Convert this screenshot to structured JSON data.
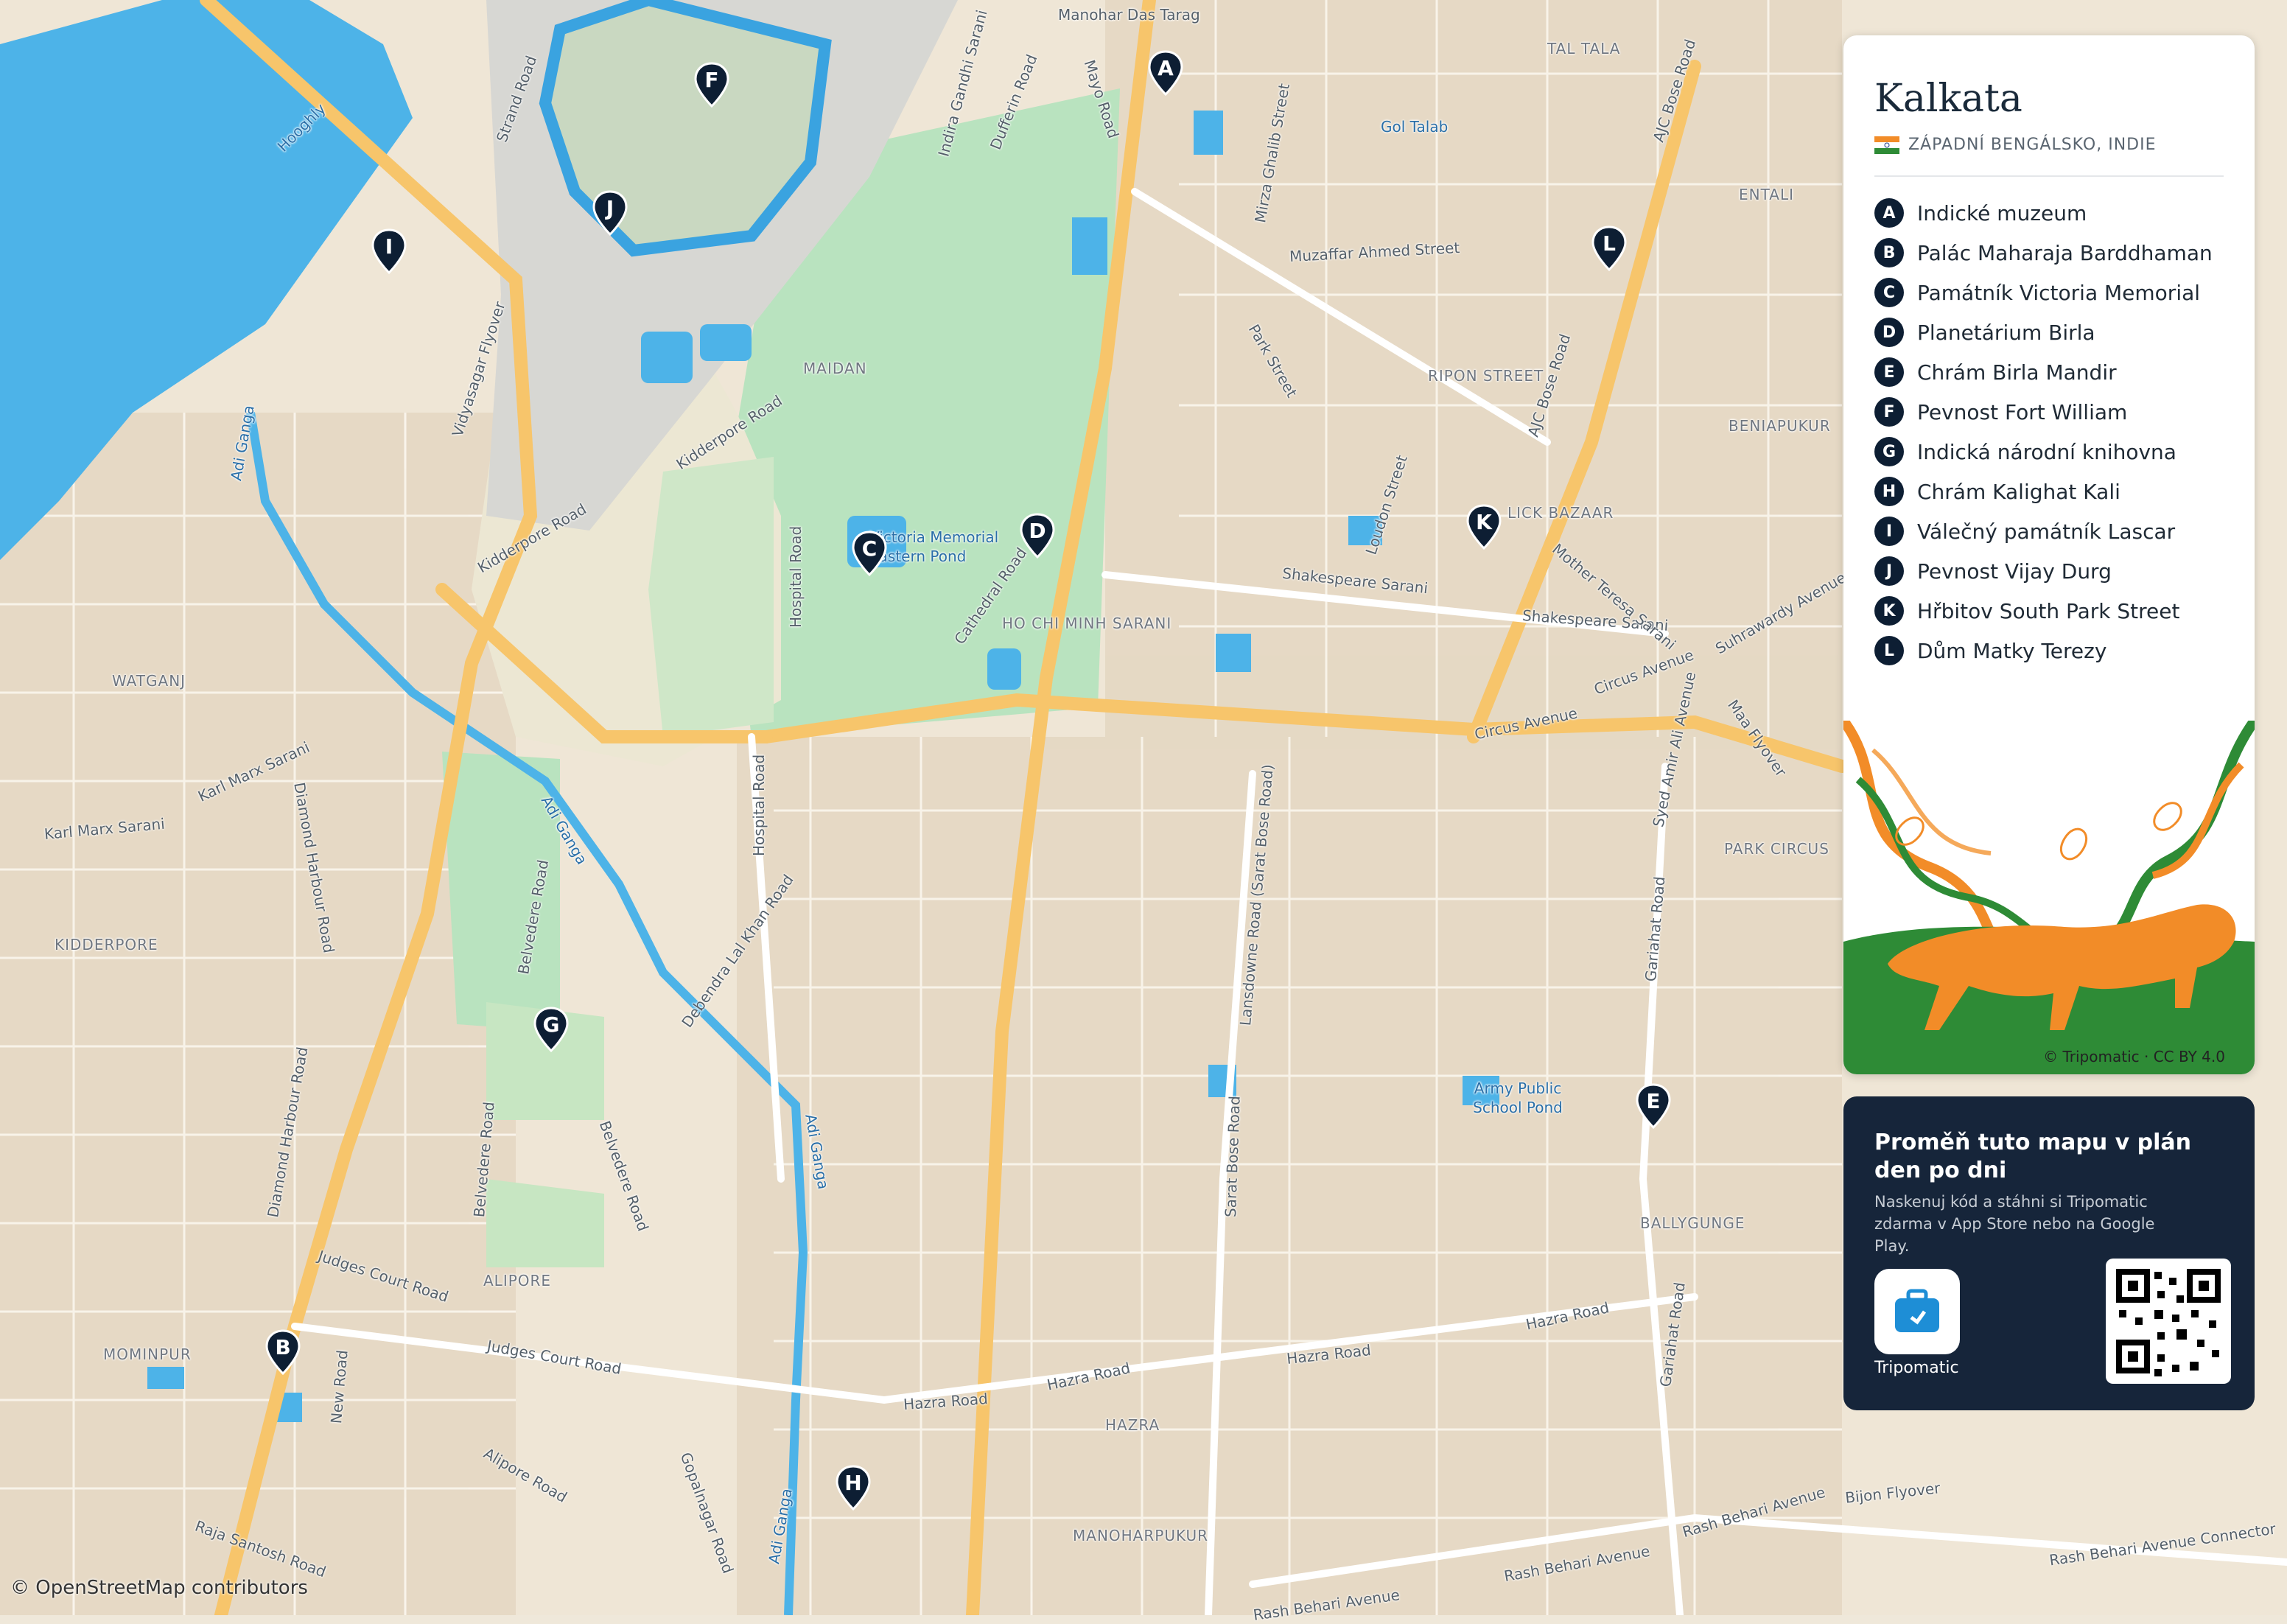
{
  "panel": {
    "city": "Kalkata",
    "region": "ZÁPADNÍ BENGÁLSKO, INDIE",
    "pois": [
      {
        "letter": "A",
        "name": "Indické muzeum"
      },
      {
        "letter": "B",
        "name": "Palác Maharaja Barddhaman"
      },
      {
        "letter": "C",
        "name": "Památník Victoria Memorial"
      },
      {
        "letter": "D",
        "name": "Planetárium Birla"
      },
      {
        "letter": "E",
        "name": "Chrám Birla Mandir"
      },
      {
        "letter": "F",
        "name": "Pevnost Fort William"
      },
      {
        "letter": "G",
        "name": "Indická národní knihovna"
      },
      {
        "letter": "H",
        "name": "Chrám Kalighat Kali"
      },
      {
        "letter": "I",
        "name": "Válečný památník Lascar"
      },
      {
        "letter": "J",
        "name": "Pevnost Vijay Durg"
      },
      {
        "letter": "K",
        "name": "Hřbitov South Park Street"
      },
      {
        "letter": "L",
        "name": "Dům Matky Terezy"
      }
    ],
    "illustration_credit": "© Tripomatic · CC BY 4.0"
  },
  "promo": {
    "title": "Proměň tuto mapu v plán den po dni",
    "description": "Naskenuj kód a stáhni si Tripomatic zdarma v App Store nebo na Google Play.",
    "app_name": "Tripomatic"
  },
  "map": {
    "attribution": "© OpenStreetMap contributors",
    "markers": [
      "A",
      "B",
      "C",
      "D",
      "E",
      "F",
      "G",
      "H",
      "I",
      "J",
      "K",
      "L"
    ],
    "districts": [
      "TAL TALA",
      "ENTALI",
      "BENIAPUKUR",
      "MAIDAN",
      "RIPON STREET",
      "WATGANJ",
      "KIDDERPORE",
      "PARK CIRCUS",
      "ALIPORE",
      "MOMINPUR",
      "HAZRA",
      "BALLYGUNGE",
      "HO CHI MINH SARANI",
      "MANOHARPUKUR",
      "LICK BAZAAR"
    ],
    "streets": [
      "Mayo Road",
      "Dufferin Road",
      "Indira Gandhi Sarani",
      "Strand Road",
      "Vidyasagar Flyover",
      "Kidderpore Road",
      "Hospital Road",
      "Cathedral Road",
      "Mirza Ghalib Street",
      "Muzaffar Ahmed Street",
      "Park Street",
      "AJC Bose Road",
      "Loudon Street",
      "Shakespeare Sarani",
      "Mother Teresa Sarani",
      "Suhrawardy Avenue",
      "Circus Avenue",
      "Maa Flyover",
      "Syed Amir Ali Avenue",
      "Karl Marx Sarani",
      "Diamond Harbour Road",
      "Adi Ganga",
      "Belvedere Road",
      "Debendra Lal Khan Road",
      "Lansdowne Road (Sarat Bose Road)",
      "Sarat Bose Road",
      "Gariahat Road",
      "Judges Court Road",
      "Hazra Road",
      "Alipore Road",
      "Gopalnagar Road",
      "Rash Behari Avenue",
      "Rash Behari Avenue Connector",
      "Bijon Flyover",
      "New Road",
      "Raja Santosh Road",
      "Manohar Das Tarag",
      "Hooghly"
    ],
    "water_labels": [
      "Gol Talab",
      "Victoria Memorial Eastern Pond",
      "Army Public School Pond"
    ]
  }
}
